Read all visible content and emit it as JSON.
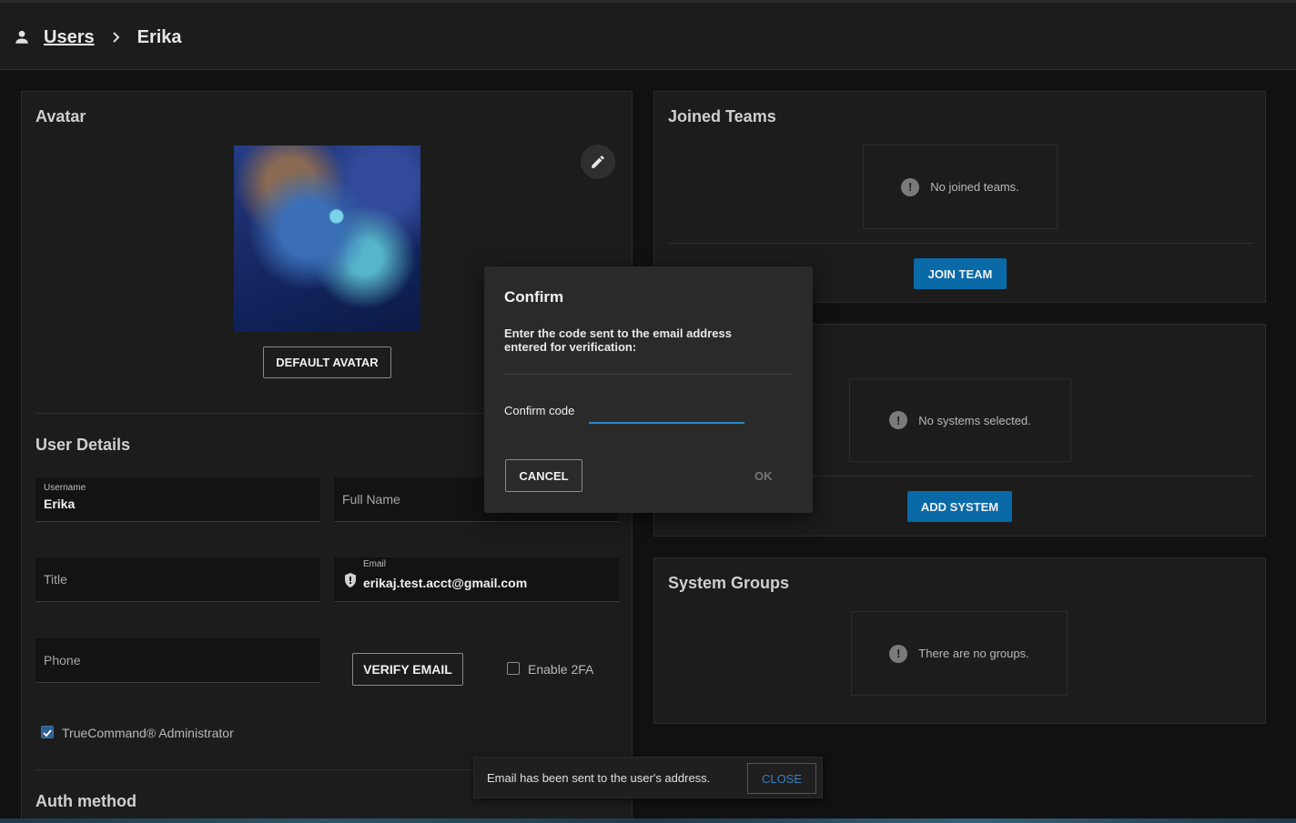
{
  "breadcrumb": {
    "icon": "person-icon",
    "parent": "Users",
    "current": "Erika"
  },
  "avatar_card": {
    "title": "Avatar",
    "default_avatar_button": "DEFAULT AVATAR",
    "edit_icon": "pencil-icon"
  },
  "user_details": {
    "title": "User Details",
    "username": {
      "label": "Username",
      "value": "Erika"
    },
    "full_name": {
      "placeholder": "Full Name"
    },
    "title_field": {
      "placeholder": "Title"
    },
    "email": {
      "label": "Email",
      "value": "erikaj.test.acct@gmail.com",
      "icon": "shield-icon"
    },
    "phone": {
      "placeholder": "Phone"
    },
    "verify_email_button": "VERIFY EMAIL",
    "enable_2fa": {
      "label": "Enable 2FA",
      "checked": false
    },
    "admin": {
      "label": "TrueCommand® Administrator",
      "checked": true
    },
    "auth_method_title": "Auth method"
  },
  "joined_teams": {
    "title": "Joined Teams",
    "empty_text": "No joined teams.",
    "button": "JOIN TEAM"
  },
  "systems": {
    "empty_text": "No systems selected.",
    "button": "ADD SYSTEM"
  },
  "system_groups": {
    "title": "System Groups",
    "empty_text": "There are no groups."
  },
  "dialog": {
    "title": "Confirm",
    "message": "Enter the code sent to the email address entered for verification:",
    "field_label": "Confirm code",
    "field_value": "",
    "cancel": "CANCEL",
    "ok": "OK"
  },
  "snackbar": {
    "message": "Email has been sent to the user's address.",
    "close": "CLOSE"
  },
  "colors": {
    "primary": "#0a6aa8",
    "accent_underline": "#2a86c8",
    "background": "#111111",
    "card": "#1c1c1c"
  }
}
